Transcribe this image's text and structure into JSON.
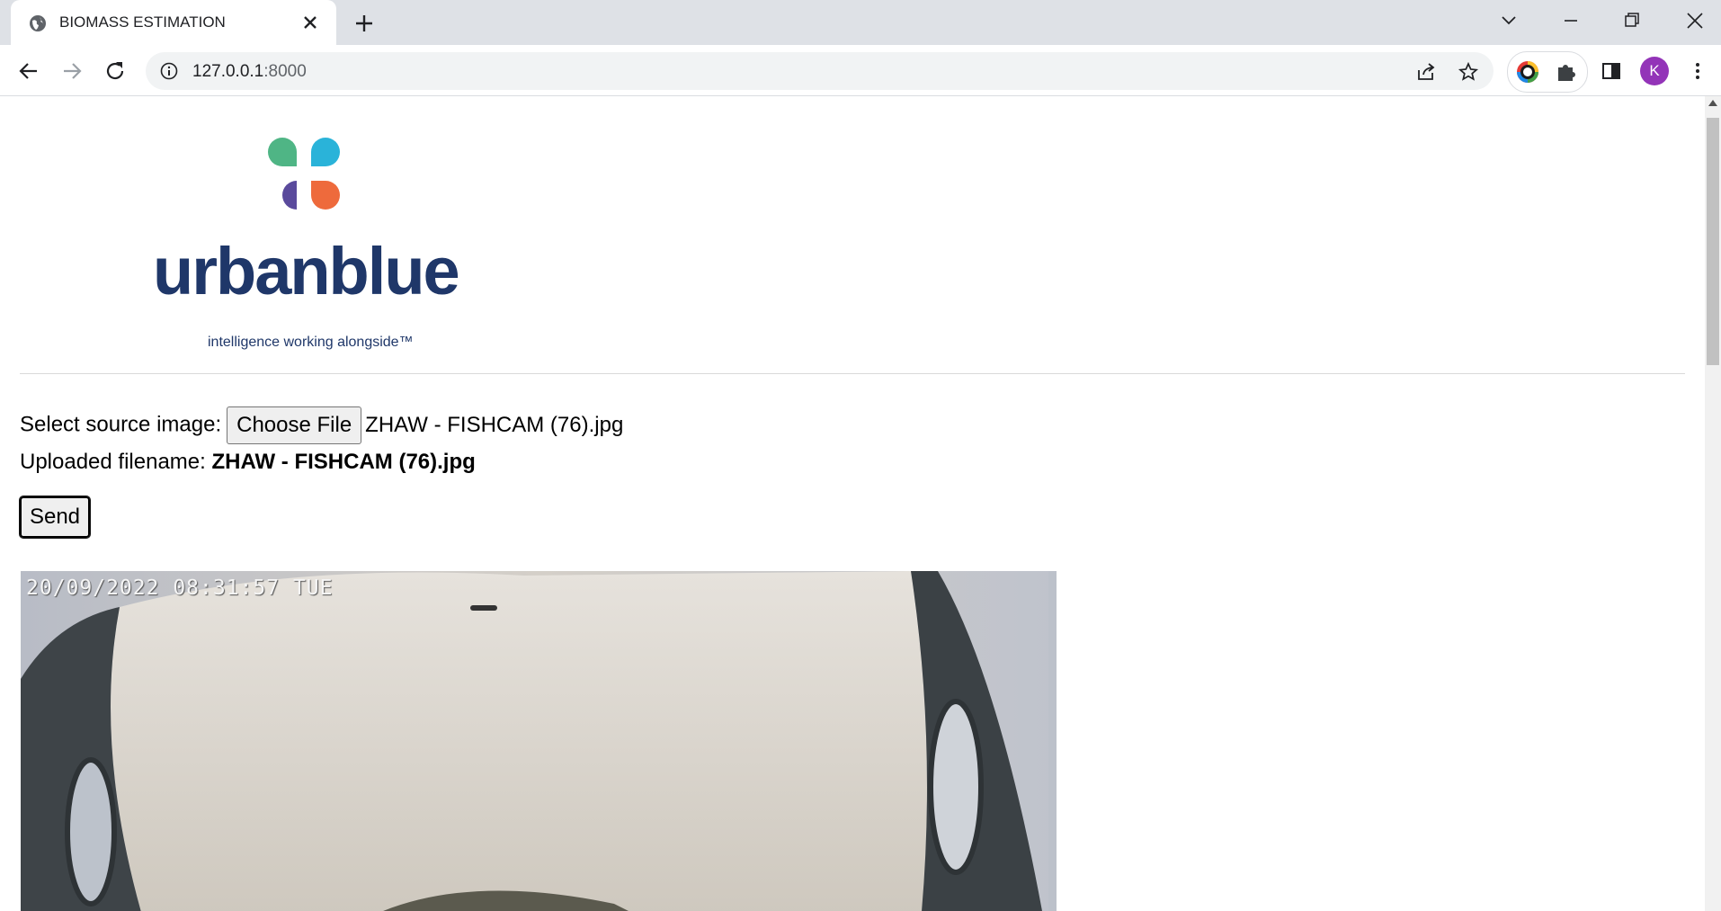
{
  "browser": {
    "tab_title": "BIOMASS ESTIMATION",
    "url_host": "127.0.0.1",
    "url_port": ":8000",
    "avatar_letter": "K"
  },
  "logo": {
    "wordmark": "urbanblue",
    "tagline": "intelligence working alongside™",
    "colors": {
      "teal": "#2ab3d9",
      "green": "#4fb585",
      "orange": "#ee6a3c",
      "purple": "#5a4a9c",
      "navy": "#1f3769"
    }
  },
  "form": {
    "select_label": "Select source image:",
    "choose_file_label": "Choose File",
    "selected_file": "ZHAW - FISHCAM (76).jpg",
    "uploaded_label": "Uploaded filename:",
    "uploaded_filename": "ZHAW - FISHCAM (76).jpg",
    "send_label": "Send"
  },
  "camera_image": {
    "timestamp": "20/09/2022 08:31:57 TUE"
  }
}
